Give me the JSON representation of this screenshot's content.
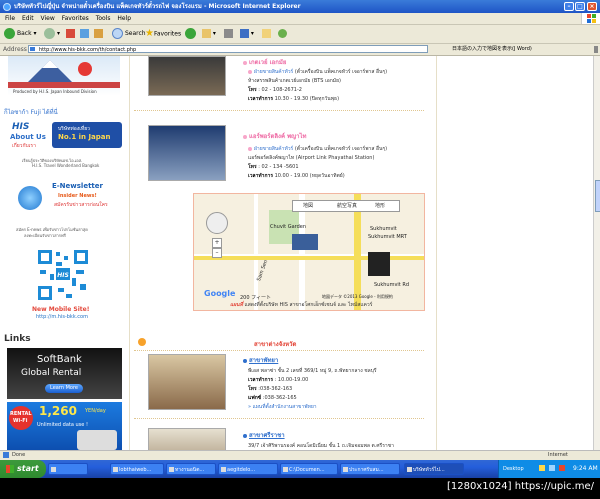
{
  "window": {
    "title": "บริษัททัวร์ไปญี่ปุ่น จำหน่ายตั๋วเครื่องบิน แพ็คเกจทัวร์ตั๋วรถไฟ จองโรงแรม - Microsoft Internet Explorer"
  },
  "menu": [
    "File",
    "Edit",
    "View",
    "Favorites",
    "Tools",
    "Help"
  ],
  "toolbar": {
    "back": "Back",
    "search": "Search",
    "favorites": "Favorites"
  },
  "address": {
    "label": "Address",
    "url": "http://www.his-bkk.com/th/contact.php",
    "jp_text": "日本語の入力で地図を表示(J Word)"
  },
  "sidebar": {
    "banner_caption": "Produced by H.I.S. Japan Inbound Division",
    "fuji_link": "ก็ไอซาก้า Fuji ได้ที่นี่",
    "about": {
      "title": "About Us",
      "sub": "เกี่ยวกับเรา",
      "badge_line1": "บริษัทท่องเที่ยว",
      "badge_line2": "No.1 in Japan",
      "desc1": "เรียนรู้ประวัติของบริษัทเอช.ไอ.เอส.",
      "desc2": "H.I.S. Travel Wonderland Bangkok"
    },
    "newsletter": {
      "title": "E-Newsletter",
      "sub": "Insider News!",
      "sub2": "สมัครรับข่าวสารก่อนใคร",
      "desc1": "สมัคร E-news เพื่อรับข่าวโปรโมชั่นล่าสุด",
      "desc2": "ลงทะเบียนรับข่าวสารฟรี"
    },
    "mobile": {
      "title": "New Mobile Site!",
      "url": "http://m.his-bkk.com"
    },
    "links_heading": "Links",
    "softbank": {
      "line1": "SoftBank",
      "line2": "Global Rental",
      "button": "Learn More"
    },
    "rental": {
      "line1": "RENTAL",
      "line2": "Wi-Fi",
      "price": "1,260",
      "unit": "YEN/day",
      "unlimited": "Unlimited data use !"
    }
  },
  "stores": [
    {
      "name": "เกตเวย์ เอกมัย",
      "dept_label": "ฝ่ายขายสินค้าทัวร์",
      "dept_desc": "(ตั๋วเครื่องบิน แพ็คเกจทัวร์ เจอาร์พาส อื่นๆ)",
      "address": "ห้างสรรพสินค้าเกตเวย์เอกมัย (BTS เอกมัย)",
      "phone_label": "โทร",
      "phone": ": 02 - 108-2671-2",
      "hours_label": "เวลาทำการ",
      "hours": "10.30 - 19.30 (ปิดทุกวันพุธ)"
    },
    {
      "name": "แอร์พอร์ตลิงค์ พญาไท",
      "dept_label": "ฝ่ายขายสินค้าทัวร์",
      "dept_desc": "(ตั๋วเครื่องบิน แพ็คเกจทัวร์ เจอาร์พาส อื่นๆ)",
      "address": "แอร์พอร์ตลิงค์พญาไท (Airport Link Phayathai Station)",
      "phone_label": "โทร",
      "phone": ": 02 - 134 -5601",
      "hours_label": "เวลาทำการ",
      "hours": "10.00 - 19.00 (หยุดวันอาทิตย์)"
    }
  ],
  "map": {
    "labels": [
      "Sukhumvit",
      "Sukhumvit MRT",
      "Sukhumvit",
      "Sam Sen",
      "Chuvit Garden",
      "Sukhumvit Rd",
      "Asoke Rd"
    ],
    "tabs": [
      "地図",
      "航空写真",
      "地形"
    ],
    "zoom_label": "200 フィート",
    "copyright": "地図データ ©2013 Google - 利用規約",
    "google": "Google",
    "caption_red": "แผนที่",
    "caption": "แสดงที่ตั้งบริษัท HIS สาขาอโศกเอ็กซ์เชนจ์ และ ไทม์สแควร์"
  },
  "section": {
    "title": "สาขาต่างจังหวัด"
  },
  "branches": [
    {
      "name": "สาขาพัทยา",
      "address": "พีเอส พลาซ่า ชั้น 2 เลขที่ 369/1 หมู่ 9, ถ.พัทยากลาง ชลบุรี",
      "hours_label": "เวลาทำการ",
      "hours": ": 10.00-19.00",
      "phone_label": "โทร",
      "phone": ":038-362-163",
      "fax_label": "แฟกซ์",
      "fax": ":038-362-165",
      "map_link": "แผนที่ตั้งสำนักงานสาขาพัทยา"
    },
    {
      "name": "สาขาศรีราชา",
      "address": "39/7 เจ้าศิริพานรองค์ คอนโดมิเนี่ยม ชั้น 1 ถ.เจิมจอมพล ต.ศรีราชา"
    }
  ],
  "statusbar": {
    "done": "Done",
    "zone": "Internet"
  },
  "taskbar": {
    "start": "start",
    "buttons": [
      "lobthaiweb...",
      "ทางานอนิต...",
      "aegitdelo...",
      "C:\\Documen...",
      "ประกาศรับสม...",
      "บริษัททัวร์ไป..."
    ],
    "desktop": "Desktop",
    "clock": "9:24 AM"
  },
  "watermark": "[1280x1024] https://upic.me/"
}
